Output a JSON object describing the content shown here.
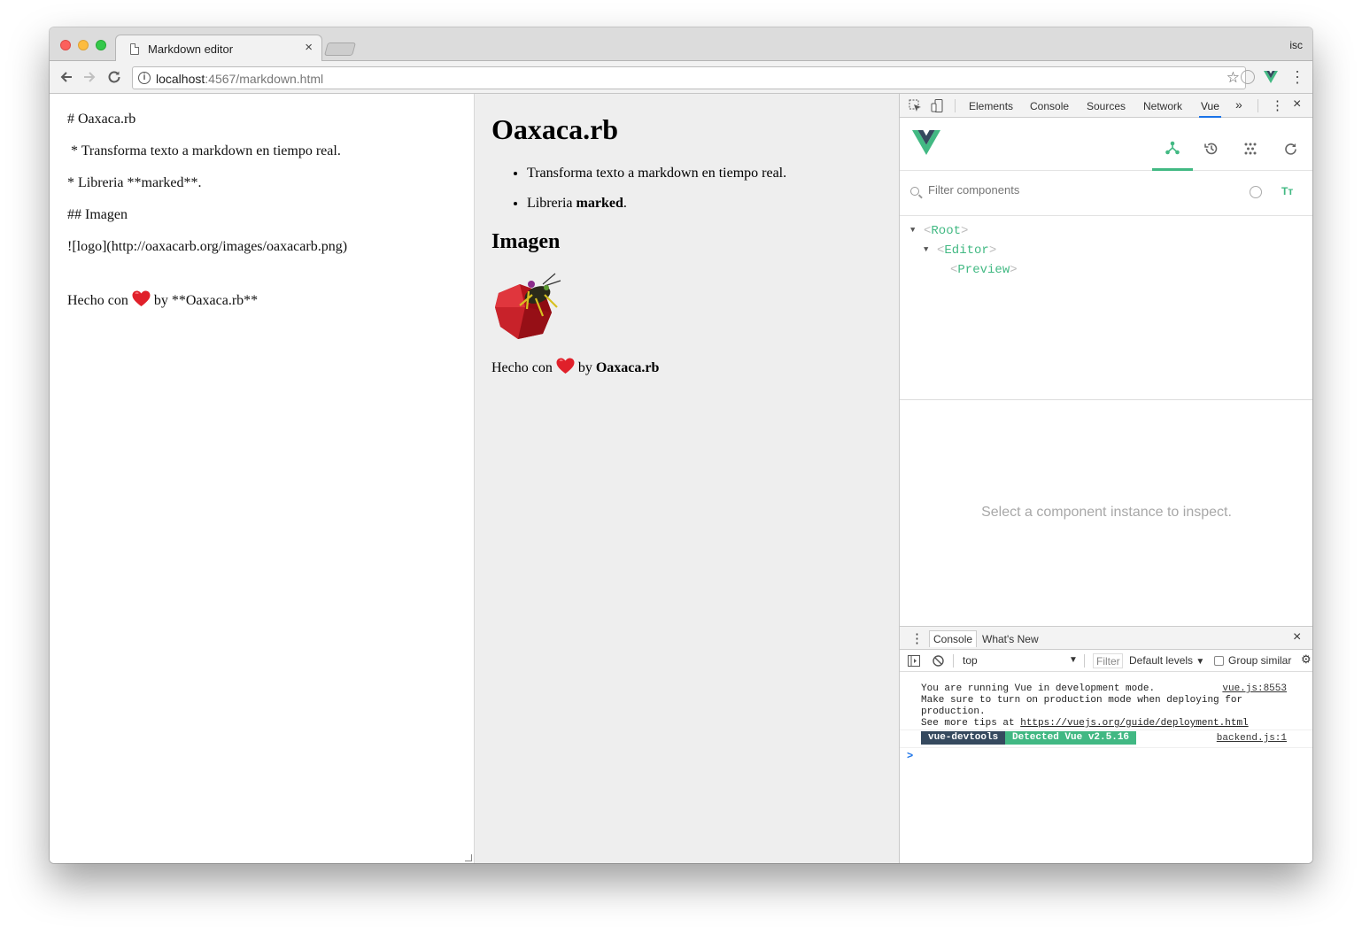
{
  "browser": {
    "tab_title": "Markdown editor",
    "tab_close": "×",
    "profile_name": "isc",
    "url_host": "localhost",
    "url_rest": ":4567/markdown.html"
  },
  "editor": {
    "lines": [
      "# Oaxaca.rb",
      " * Transforma texto a markdown en tiempo real.",
      "* Libreria **marked**.",
      "## Imagen",
      "![logo](http://oaxacarb.org/images/oaxacarb.png)",
      "Hecho con",
      "by **Oaxaca.rb**"
    ]
  },
  "preview": {
    "title": "Oaxaca.rb",
    "bullet_1": "Transforma texto a markdown en tiempo real.",
    "bullet_2_prefix": "Libreria ",
    "bullet_2_bold": "marked",
    "bullet_2_suffix": ".",
    "subtitle": "Imagen",
    "footer_prefix": "Hecho con",
    "footer_by": "by",
    "footer_bold": "Oaxaca.rb"
  },
  "devtools": {
    "tabs": [
      "Elements",
      "Console",
      "Sources",
      "Network",
      "Vue"
    ],
    "active_tab": "Vue",
    "more": "»",
    "close": "×",
    "filter_placeholder": "Filter components",
    "tree": {
      "root": "Root",
      "editor": "Editor",
      "preview": "Preview"
    },
    "inspect_message": "Select a component instance to inspect.",
    "drawer": {
      "console_tab": "Console",
      "whats_new_tab": "What's New",
      "close": "×",
      "context": "top",
      "filter": "Filter",
      "levels": "Default levels",
      "group_similar": "Group similar"
    },
    "console": {
      "msg1_line1": "You are running Vue in development mode.",
      "msg1_line2": "Make sure to turn on production mode when deploying for",
      "msg1_line3": "production.",
      "msg1_line4_prefix": "See more tips at ",
      "msg1_link": "https://vuejs.org/guide/deployment.html",
      "msg1_source": "vue.js:8553",
      "badge_devtools": "vue-devtools",
      "badge_detected": "Detected Vue v2.5.16",
      "msg2_source": "backend.js:1",
      "prompt": ">"
    }
  },
  "colors": {
    "vue_green": "#42b983",
    "vue_dark": "#35495e",
    "heart": "#e0202a"
  }
}
